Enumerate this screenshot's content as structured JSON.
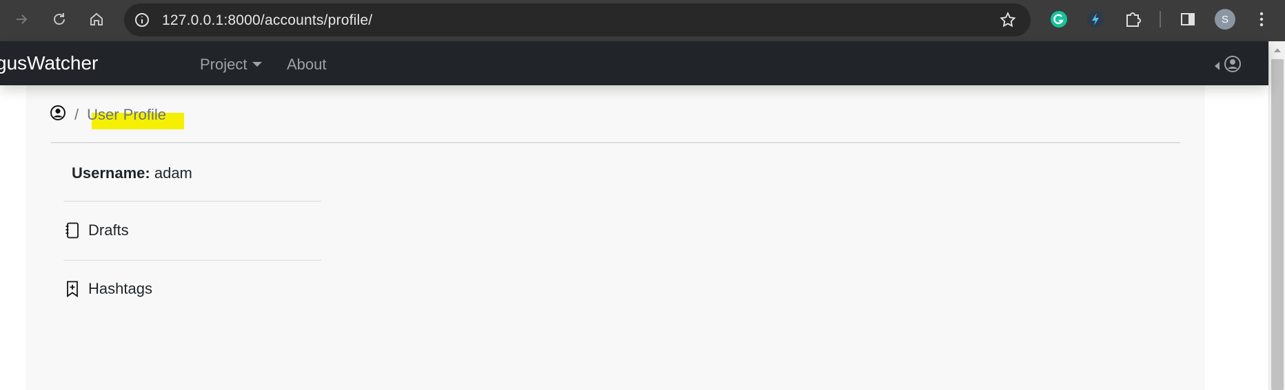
{
  "browser": {
    "url": "127.0.0.1:8000/accounts/profile/",
    "profile_initial": "S",
    "icons": [
      "forward-icon",
      "reload-icon",
      "home-icon",
      "site-info-icon",
      "bookmark-star-icon",
      "grammarly-extension-icon",
      "bolt-extension-icon",
      "extensions-puzzle-icon",
      "side-panel-icon",
      "profile-avatar",
      "more-menu-icon"
    ]
  },
  "navbar": {
    "brand": "gusWatcher",
    "links": [
      {
        "label": "Project",
        "dropdown": true
      },
      {
        "label": "About",
        "dropdown": false
      }
    ],
    "user_menu_icon": "user-circle-icon"
  },
  "breadcrumb": {
    "separator": "/",
    "current": "User Profile"
  },
  "profile": {
    "username_label": "Username:",
    "username_value": "adam",
    "items": [
      {
        "label": "Drafts",
        "icon": "journal-icon"
      },
      {
        "label": "Hashtags",
        "icon": "bookmark-plus-icon"
      }
    ]
  },
  "colors": {
    "navbar_bg": "#212529",
    "highlight": "#f5f000",
    "content_bg": "#f8f8f8"
  }
}
